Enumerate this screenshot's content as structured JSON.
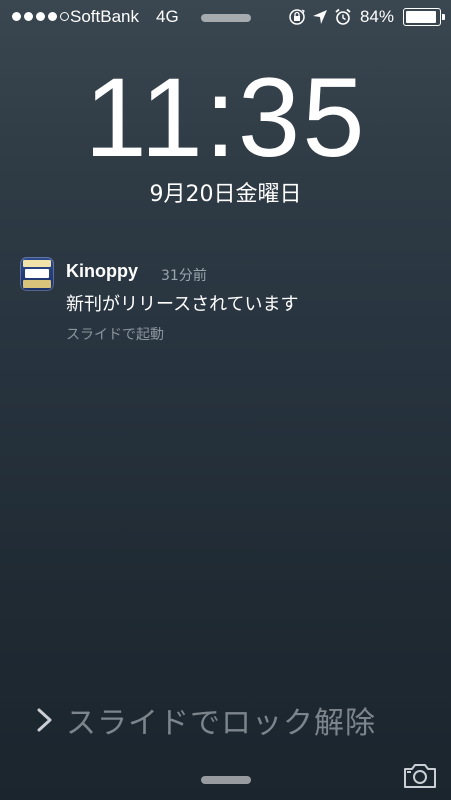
{
  "status_bar": {
    "signal_bars": 5,
    "signal_filled": 4,
    "carrier": "SoftBank",
    "network": "4G",
    "battery_percent": "84%",
    "icons": [
      "rotation-lock-icon",
      "location-arrow-icon",
      "alarm-clock-icon",
      "battery-icon"
    ]
  },
  "lock_screen": {
    "time": "11:35",
    "date": "9月20日金曜日"
  },
  "notification": {
    "app_icon": "kinoppy-app-icon",
    "app_name": "Kinoppy",
    "time_ago": "31分前",
    "message": "新刊がリリースされています",
    "action": "スライドで起動"
  },
  "unlock": {
    "icon": "chevron-right-icon",
    "label": "スライドでロック解除"
  },
  "bottom": {
    "camera_icon": "camera-icon"
  },
  "colors": {
    "background_top": "#3a4650",
    "background_bottom": "#1b252e",
    "secondary_text": "#9aa4ad",
    "unlock_text": "#7d858c"
  }
}
